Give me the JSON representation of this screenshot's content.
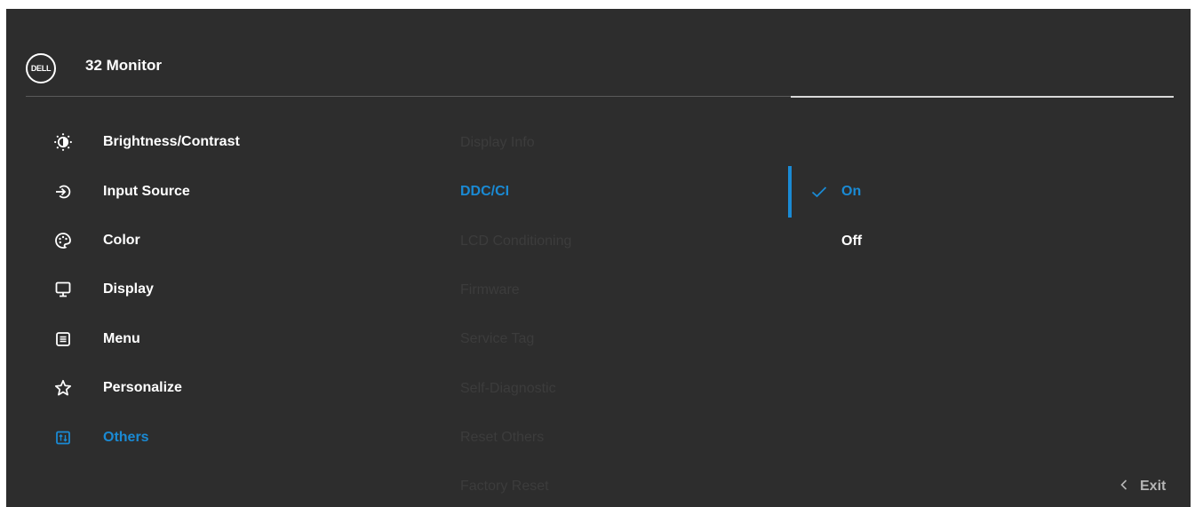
{
  "header": {
    "logo_text": "DELL",
    "title": "32 Monitor"
  },
  "menu": {
    "items": [
      {
        "label": "Brightness/Contrast",
        "icon": "brightness-icon"
      },
      {
        "label": "Input Source",
        "icon": "input-source-icon"
      },
      {
        "label": "Color",
        "icon": "color-palette-icon"
      },
      {
        "label": "Display",
        "icon": "display-monitor-icon"
      },
      {
        "label": "Menu",
        "icon": "menu-icon"
      },
      {
        "label": "Personalize",
        "icon": "star-icon"
      },
      {
        "label": "Others",
        "icon": "others-icon",
        "active": true
      }
    ]
  },
  "submenu": {
    "items": [
      {
        "label": "Display Info"
      },
      {
        "label": "DDC/CI",
        "active": true
      },
      {
        "label": "LCD Conditioning"
      },
      {
        "label": "Firmware"
      },
      {
        "label": "Service Tag"
      },
      {
        "label": "Self-Diagnostic"
      },
      {
        "label": "Reset Others"
      },
      {
        "label": "Factory Reset"
      }
    ]
  },
  "options": {
    "items": [
      {
        "label": "On",
        "selected": true
      },
      {
        "label": "Off",
        "selected": false
      }
    ]
  },
  "footer": {
    "exit_label": "Exit",
    "exit_icon": "chevron-left-icon"
  },
  "colors": {
    "background": "#2d2d2d",
    "accent": "#1a8ad4",
    "text": "#ffffff",
    "dimmed_text": "#3c3c3c"
  }
}
